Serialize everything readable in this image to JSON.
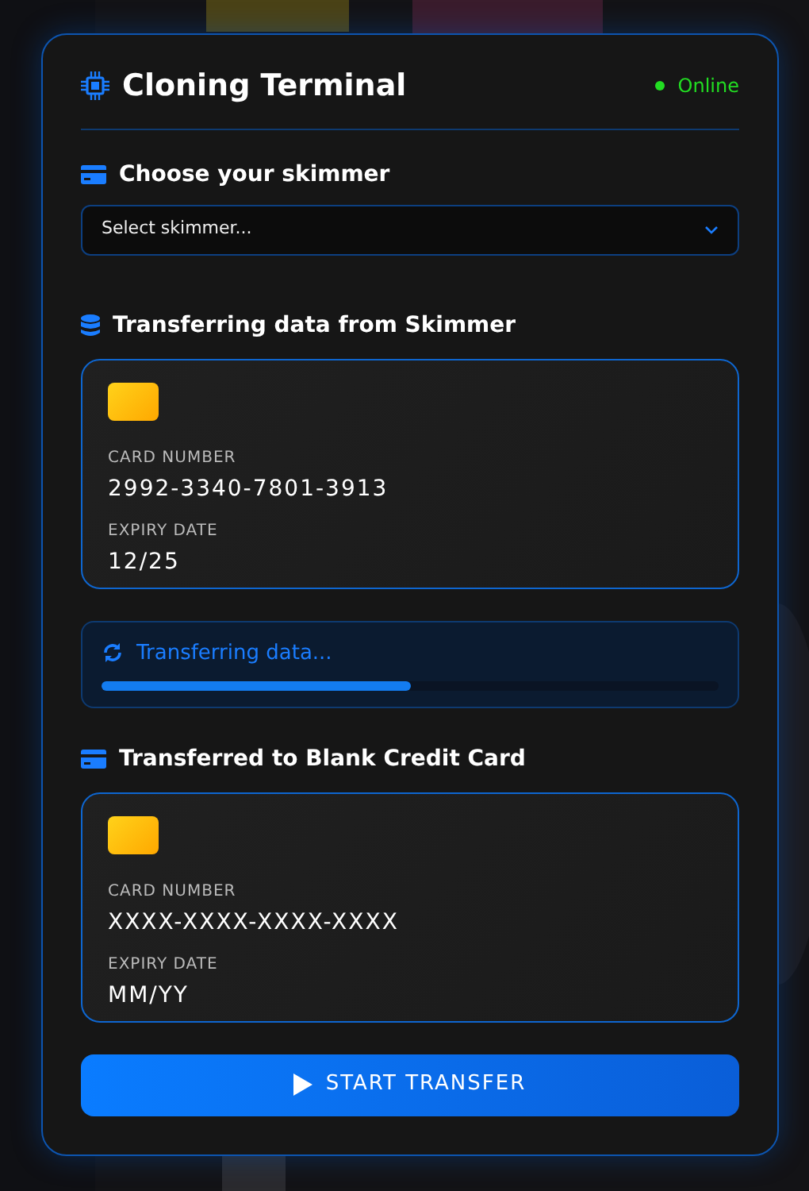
{
  "terminal": {
    "title": "Cloning Terminal",
    "status": {
      "label": "Online",
      "color": "#22dd22"
    }
  },
  "skimmer": {
    "heading": "Choose your skimmer",
    "select": {
      "value": "Select skimmer..."
    }
  },
  "source": {
    "heading": "Transferring data from Skimmer",
    "card": {
      "number_label": "CARD NUMBER",
      "number": "2992-3340-7801-3913",
      "expiry_label": "EXPIRY DATE",
      "expiry": "12/25"
    }
  },
  "progress": {
    "label": "Transferring data...",
    "level": 0.5
  },
  "target": {
    "heading": "Transferred to Blank Credit Card",
    "card": {
      "number_label": "CARD NUMBER",
      "number": "XXXX-XXXX-XXXX-XXXX",
      "expiry_label": "EXPIRY DATE",
      "expiry": "MM/YY"
    }
  },
  "button": {
    "label": "START TRANSFER"
  }
}
